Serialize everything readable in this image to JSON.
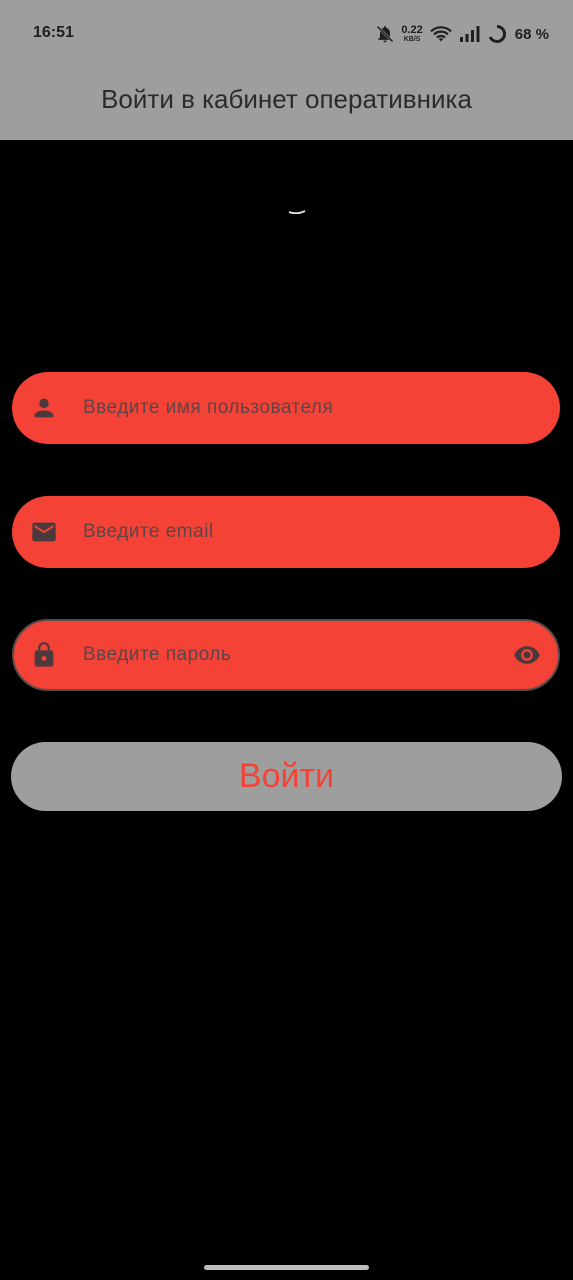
{
  "status_bar": {
    "time": "16:51",
    "net_speed": "0.22",
    "net_unit": "KB/S",
    "battery": "68 %",
    "icons": [
      "bell-off-icon",
      "wifi-icon",
      "signal-icon",
      "battery-icon"
    ]
  },
  "app_bar": {
    "title": "Войти в кабинет оперативника"
  },
  "form": {
    "username_placeholder": "Введите имя пользователя",
    "email_placeholder": "Введите email",
    "password_placeholder": "Введите пароль",
    "submit_label": "Войти"
  },
  "colors": {
    "field_bg": "#f44336",
    "app_bar_bg": "#9e9e9e",
    "background": "#000000"
  }
}
